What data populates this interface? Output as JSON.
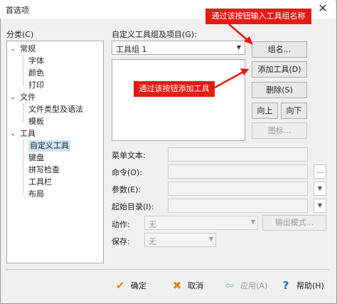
{
  "window": {
    "title": "首选项",
    "close_glyph": "✕"
  },
  "category": {
    "label": "分类(C)",
    "tree": [
      {
        "label": "常规",
        "level": 0,
        "expanded": true
      },
      {
        "label": "字体",
        "level": 1
      },
      {
        "label": "颜色",
        "level": 1
      },
      {
        "label": "打印",
        "level": 1
      },
      {
        "label": "文件",
        "level": 0,
        "expanded": true
      },
      {
        "label": "文件类型及语法",
        "level": 1
      },
      {
        "label": "模板",
        "level": 1
      },
      {
        "label": "工具",
        "level": 0,
        "expanded": true
      },
      {
        "label": "自定义工具",
        "level": 1,
        "selected": true
      },
      {
        "label": "键盘",
        "level": 1
      },
      {
        "label": "拼写检查",
        "level": 1
      },
      {
        "label": "工具栏",
        "level": 1
      },
      {
        "label": "布局",
        "level": 1
      }
    ]
  },
  "tools": {
    "group_label": "自定义工具组及项目(G):",
    "group_value": "工具组 1",
    "buttons": {
      "group_name": "组名...",
      "add_tool": "添加工具(D)",
      "delete": "删除(S)",
      "move_up": "向上",
      "move_down": "向下",
      "icon": "图标..."
    },
    "fields": {
      "menu_text": "菜单文本:",
      "command": "命令(O):",
      "params": "参数(E):",
      "start_dir": "起始目录(I):",
      "action": "动作:",
      "action_value": "无",
      "output_mode": "输出模式...",
      "save": "保存:",
      "save_value": "无",
      "browse": "..."
    }
  },
  "footer": {
    "ok": "确定",
    "cancel": "取消",
    "apply": "应用(A)",
    "help": "帮助(H)"
  },
  "annotations": {
    "group_name_callout": "通过该按钮输入工具组名称",
    "add_tool_callout": "通过该按钮添加工具",
    "color": "#e41b14"
  }
}
